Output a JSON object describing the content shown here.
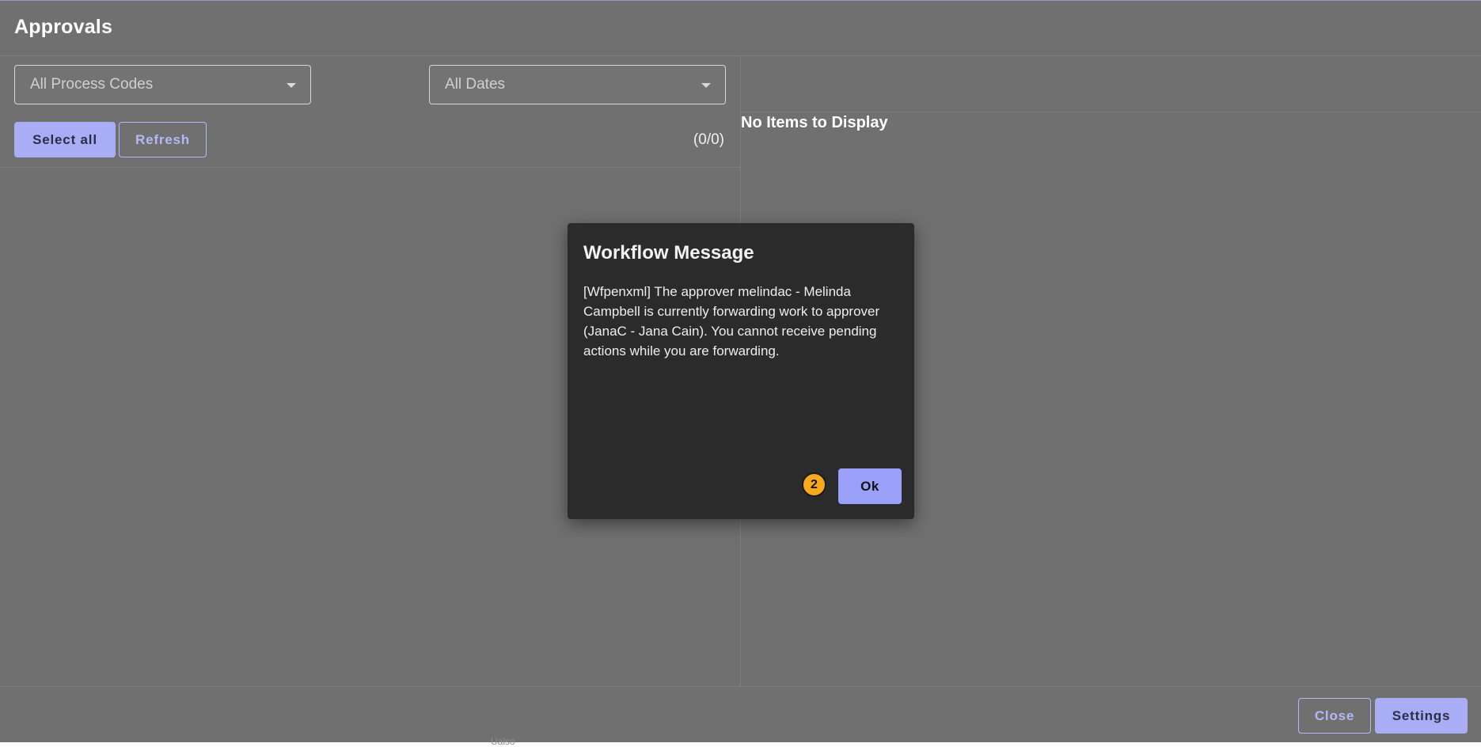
{
  "header": {
    "title": "Approvals"
  },
  "filters": {
    "process_codes": {
      "selected": "All Process Codes",
      "icon": "chevron-down-icon"
    },
    "dates": {
      "selected": "All Dates",
      "icon": "chevron-down-icon"
    }
  },
  "toolbar": {
    "select_all_label": "Select all",
    "refresh_label": "Refresh",
    "count": "(0/0)"
  },
  "detail": {
    "empty_message": "No Items to Display"
  },
  "footer": {
    "close_label": "Close",
    "settings_label": "Settings",
    "ghost_text": "Ualso"
  },
  "dialog": {
    "title": "Workflow Message",
    "message": "[Wfpenxml] The approver melindac - Melinda Campbell is currently forwarding work to approver (JanaC - Jana Cain). You cannot receive pending actions while you are forwarding.",
    "step_badge": "2",
    "ok_label": "Ok"
  },
  "colors": {
    "background": "#707070",
    "dialog_background": "#2b2b2b",
    "accent": "#a8adf6",
    "badge": "#f7a81b"
  }
}
